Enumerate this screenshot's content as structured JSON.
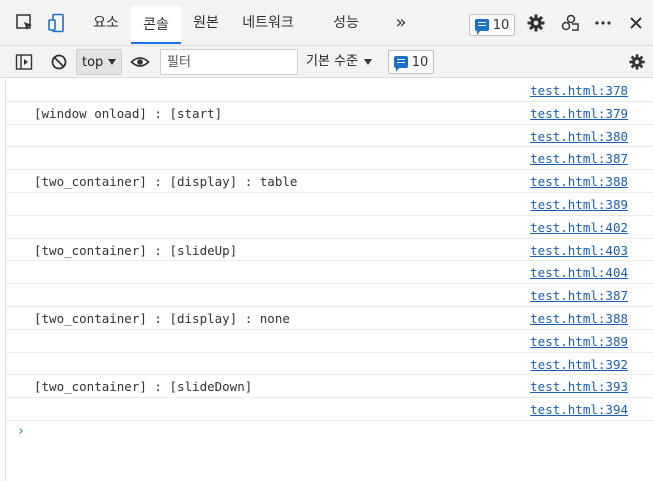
{
  "tabs": [
    {
      "label": "요소",
      "active": false
    },
    {
      "label": "콘솔",
      "active": true
    },
    {
      "label": "원본",
      "active": false
    },
    {
      "label": "네트워크",
      "active": false
    },
    {
      "label": "성능",
      "active": false
    }
  ],
  "more_tabs": "»",
  "message_count": "10",
  "toolbar": {
    "context": "top",
    "filter_placeholder": "필터",
    "levels_label": "기본 수준",
    "message_count": "10"
  },
  "logs": [
    {
      "message": "",
      "source": "test.html:378"
    },
    {
      "message": "[window onload] : [start]",
      "source": "test.html:379"
    },
    {
      "message": "",
      "source": "test.html:380"
    },
    {
      "message": "",
      "source": "test.html:387"
    },
    {
      "message": "[two_container] : [display] : table",
      "source": "test.html:388"
    },
    {
      "message": "",
      "source": "test.html:389"
    },
    {
      "message": "",
      "source": "test.html:402"
    },
    {
      "message": "[two_container] : [slideUp]",
      "source": "test.html:403"
    },
    {
      "message": "",
      "source": "test.html:404"
    },
    {
      "message": "",
      "source": "test.html:387"
    },
    {
      "message": "[two_container] : [display] : none",
      "source": "test.html:388"
    },
    {
      "message": "",
      "source": "test.html:389"
    },
    {
      "message": "",
      "source": "test.html:392"
    },
    {
      "message": "[two_container] : [slideDown]",
      "source": "test.html:393"
    },
    {
      "message": "",
      "source": "test.html:394"
    }
  ],
  "prompt_symbol": "›",
  "colors": {
    "accent": "#1a73e8",
    "link": "#1a5fb4",
    "badge": "#1a6fc7"
  }
}
